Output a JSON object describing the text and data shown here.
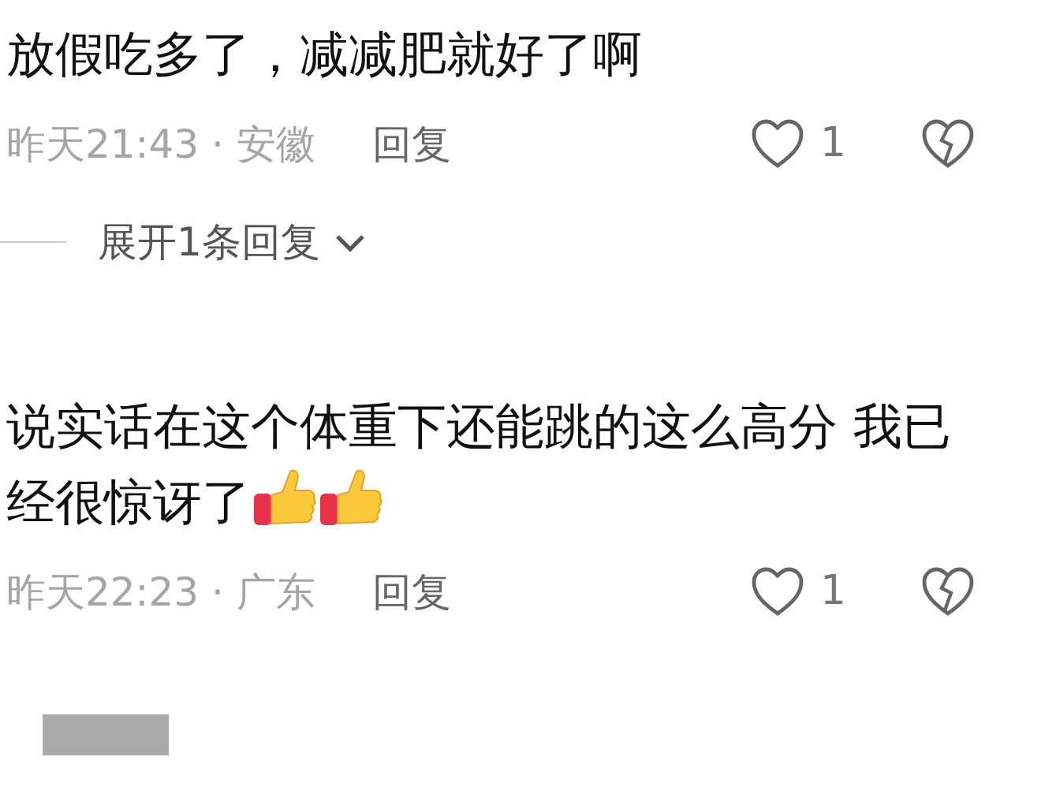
{
  "comments": [
    {
      "text": "放假吃多了，减减肥就好了啊",
      "meta": "昨天21:43 · 安徽",
      "reply_label": "回复",
      "likes": "1",
      "liked": false,
      "replies_toggle": {
        "label": "展开1条回复",
        "expanded": false
      }
    },
    {
      "text": "说实话在这个体重下还能跳的这么高分 我已经很惊讶了",
      "emojis": [
        {
          "kind": "thumbs_up"
        },
        {
          "kind": "thumbs_up"
        }
      ],
      "meta": "昨天22:23 · 广东",
      "reply_label": "回复",
      "likes": "1",
      "liked": false
    }
  ]
}
